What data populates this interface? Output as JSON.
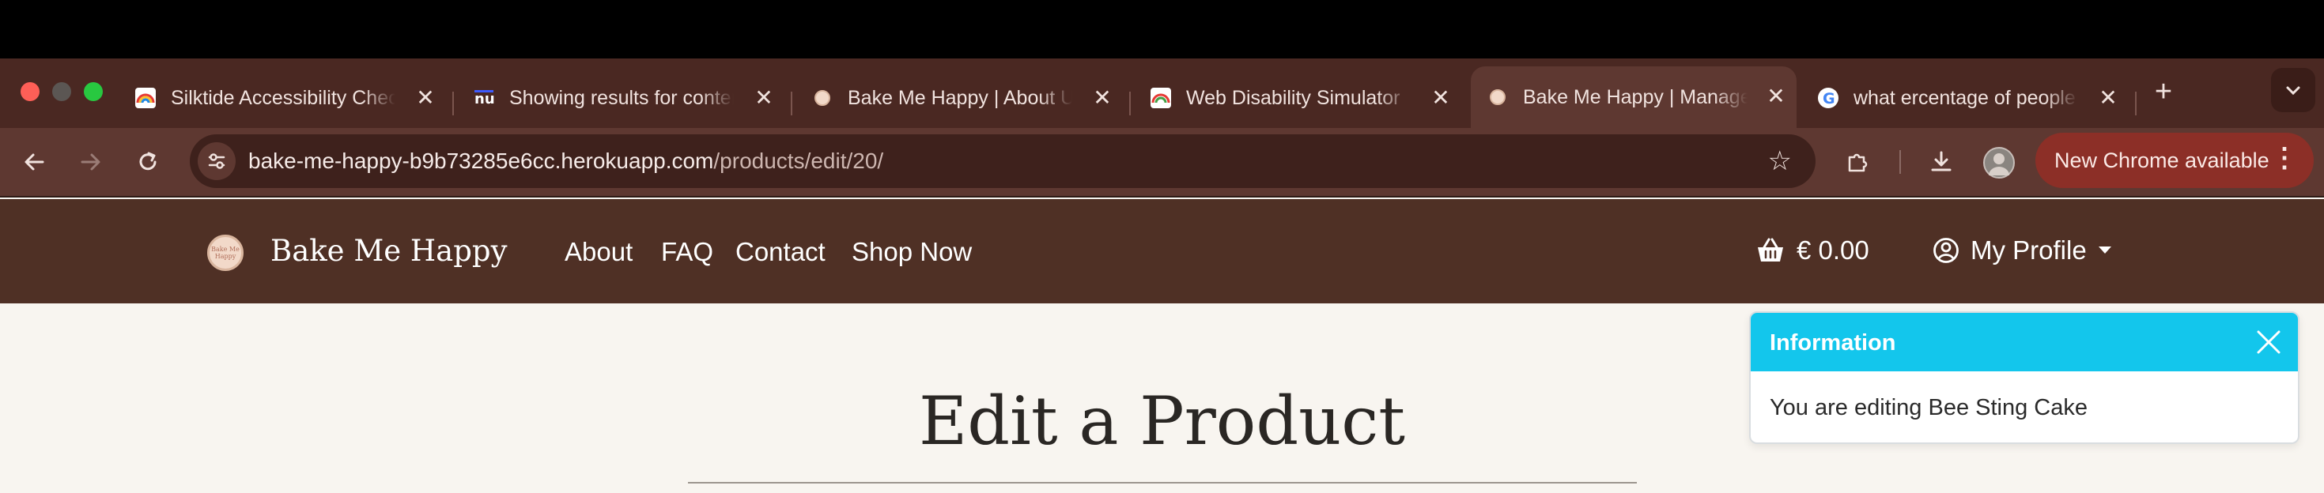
{
  "browser": {
    "tabs": [
      {
        "title": "Silktide Accessibility Checker",
        "icon": "silktide-rainbow-icon",
        "close": "✕"
      },
      {
        "title": "Showing results for contents",
        "icon": "nu-html-checker-icon",
        "close": "✕"
      },
      {
        "title": "Bake Me Happy | About Us",
        "icon": "bake-me-happy-favicon",
        "close": "✕"
      },
      {
        "title": "Web Disability Simulator",
        "icon": "disability-simulator-icon",
        "close": "✕"
      },
      {
        "title": "Bake Me Happy | Manage Products",
        "icon": "bake-me-happy-favicon",
        "close": "✕"
      },
      {
        "title": "what ercentage of people",
        "icon": "google-g-icon",
        "close": "✕"
      }
    ],
    "new_tab": "+",
    "url_host": "bake-me-happy-b9b73285e6cc.herokuapp.com",
    "url_path": "/products/edit/20/",
    "update_label": "New Chrome available",
    "update_menu": "⋮",
    "colors": {
      "tabstrip": "#4a2822",
      "toolbar": "#5e3831",
      "update_pill": "#8c2f27"
    }
  },
  "site": {
    "logo_text": "Bake Me Happy",
    "brand": "Bake Me Happy",
    "nav": [
      "About",
      "FAQ",
      "Contact",
      "Shop Now"
    ],
    "cart_total": "€ 0.00",
    "profile_label": "My Profile",
    "colors": {
      "nav": "#4f3025",
      "page": "#f8f5f0"
    }
  },
  "main": {
    "heading": "Edit a Product"
  },
  "toast": {
    "title": "Information",
    "message": "You are editing Bee Sting Cake",
    "color": "#13c6ec"
  }
}
